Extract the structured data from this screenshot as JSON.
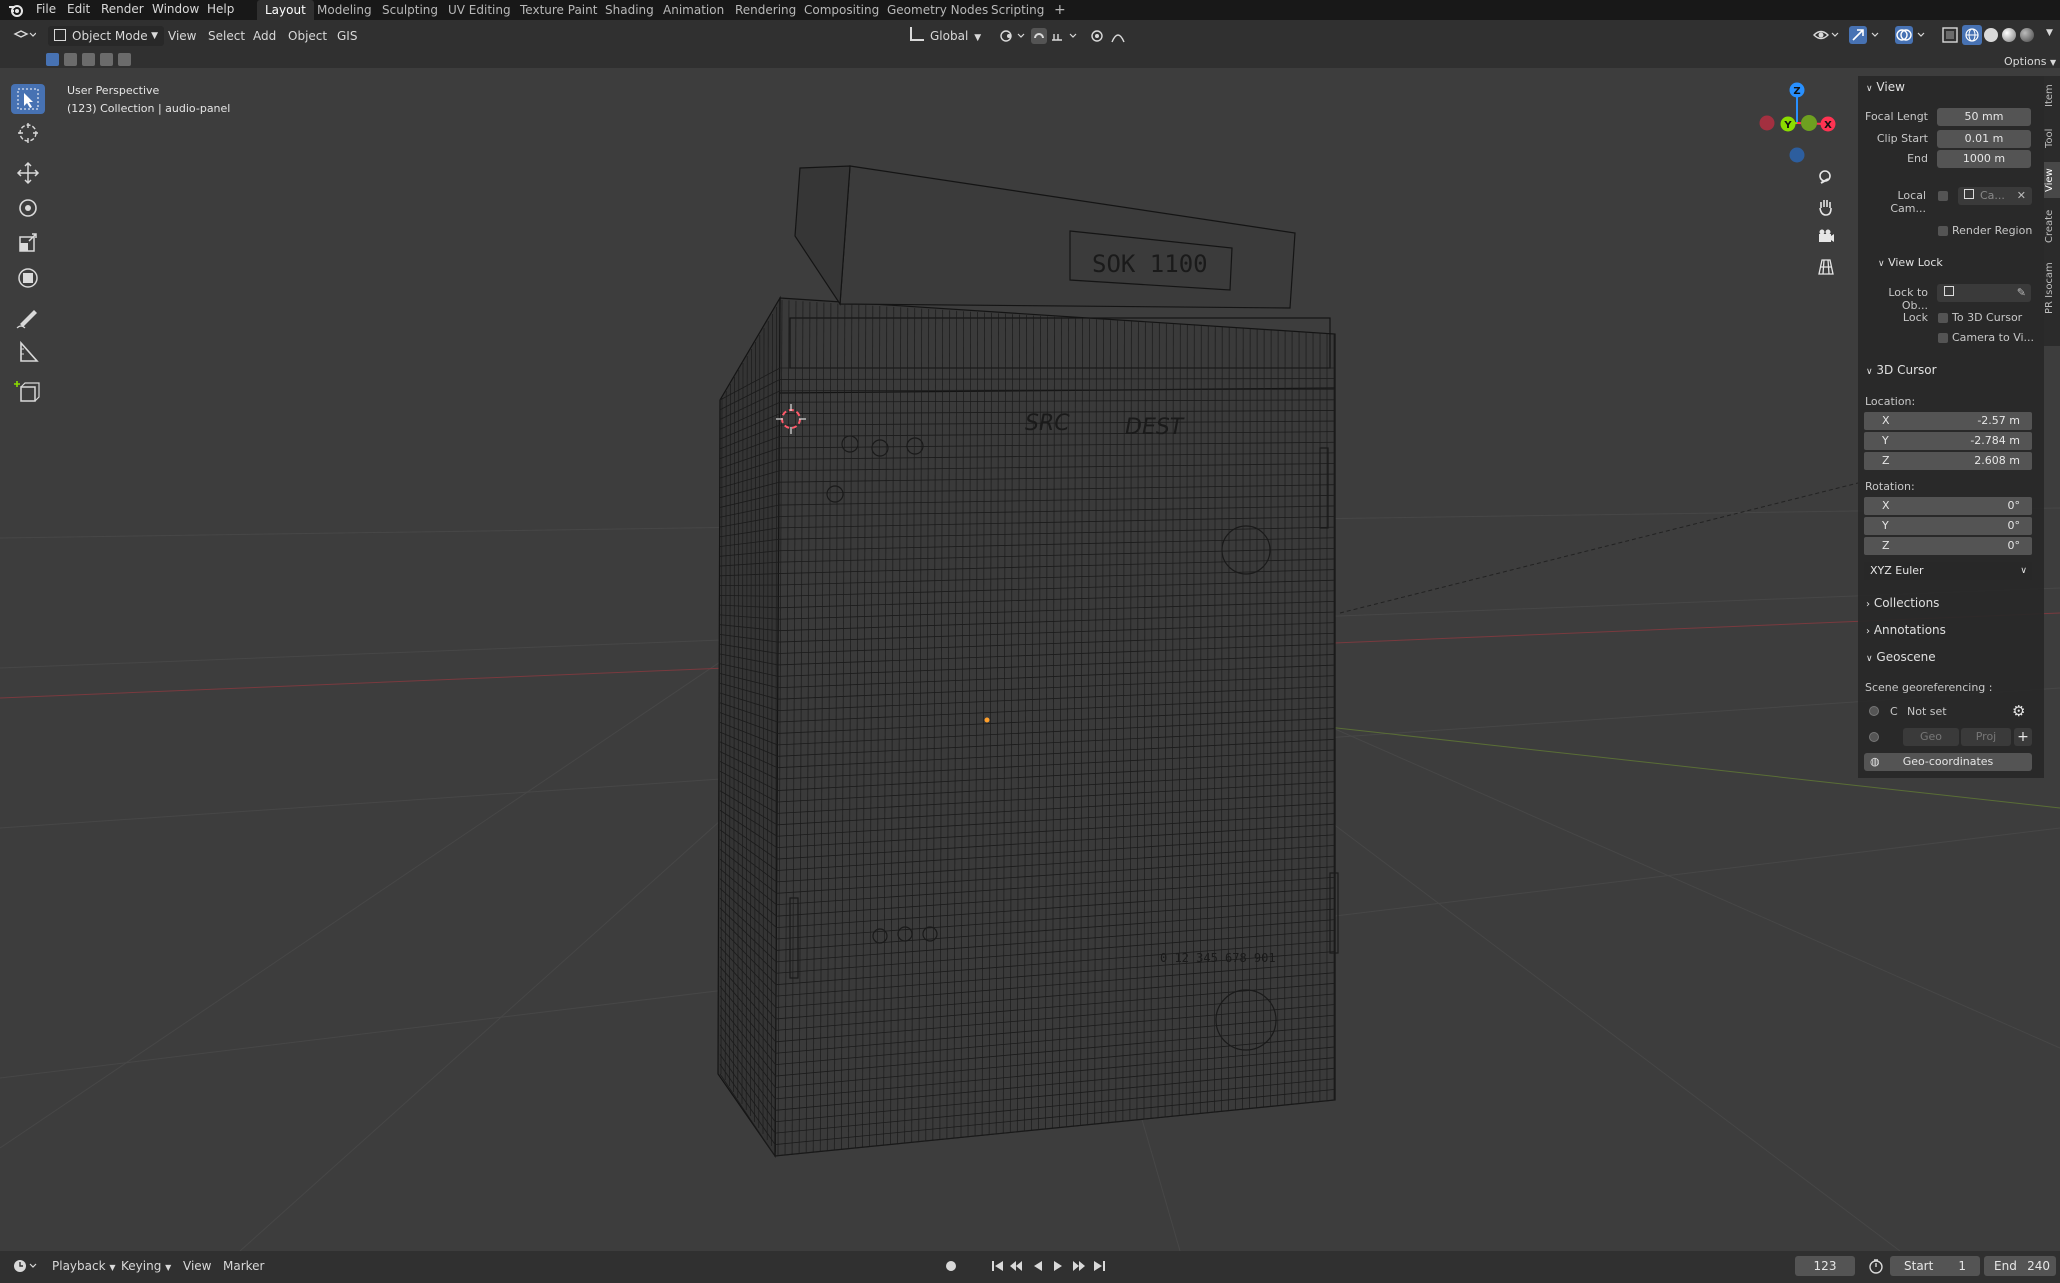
{
  "menubar": {
    "items": [
      "File",
      "Edit",
      "Render",
      "Window",
      "Help"
    ],
    "workspaces": [
      "Layout",
      "Modeling",
      "Sculpting",
      "UV Editing",
      "Texture Paint",
      "Shading",
      "Animation",
      "Rendering",
      "Compositing",
      "Geometry Nodes",
      "Scripting"
    ],
    "active_workspace": "Layout",
    "add_tab": "+"
  },
  "header": {
    "mode": "Object Mode",
    "menus": [
      "View",
      "Select",
      "Add",
      "Object",
      "GIS"
    ],
    "orientation": "Global",
    "options": "Options"
  },
  "viewport": {
    "perspective": "User Perspective",
    "collection": "(123) Collection | audio-panel",
    "gizmo": {
      "x": "X",
      "y": "Y",
      "z": "Z"
    },
    "model_text": {
      "top_display": "SOK 1100",
      "src": "SRC",
      "dest": "DEST",
      "counter": "0 12 345 678 901"
    }
  },
  "npanel": {
    "tabs": [
      "Item",
      "Tool",
      "View",
      "Create",
      "PR Isocam"
    ],
    "view": {
      "title": "View",
      "focal_label": "Focal Lengt",
      "focal_value": "50 mm",
      "clip_start_label": "Clip Start",
      "clip_start_value": "0.01 m",
      "end_label": "End",
      "end_value": "1000 m",
      "local_cam_label": "Local Cam...",
      "local_cam_value": "Ca...",
      "render_region": "Render Region"
    },
    "view_lock": {
      "title": "View Lock",
      "lock_to_label": "Lock to Ob...",
      "lock_label": "Lock",
      "to_cursor": "To 3D Cursor",
      "camera_to_view": "Camera to Vi..."
    },
    "cursor": {
      "title": "3D Cursor",
      "location_label": "Location:",
      "location": [
        {
          "axis": "X",
          "value": "-2.57 m"
        },
        {
          "axis": "Y",
          "value": "-2.784 m"
        },
        {
          "axis": "Z",
          "value": "2.608 m"
        }
      ],
      "rotation_label": "Rotation:",
      "rotation": [
        {
          "axis": "X",
          "value": "0°"
        },
        {
          "axis": "Y",
          "value": "0°"
        },
        {
          "axis": "Z",
          "value": "0°"
        }
      ],
      "rotation_mode": "XYZ Euler"
    },
    "collections": "Collections",
    "annotations": "Annotations",
    "geoscene": {
      "title": "Geoscene",
      "georef_label": "Scene georeferencing :",
      "crs_prefix": "C",
      "crs_value": "Not set",
      "geo_btn": "Geo",
      "proj_btn": "Proj",
      "add": "+",
      "geo_coords": "Geo-coordinates"
    }
  },
  "timeline": {
    "menus": [
      "Playback",
      "Keying",
      "View",
      "Marker"
    ],
    "current_frame": "123",
    "start_label": "Start",
    "start": "1",
    "end_label": "End",
    "end": "240"
  },
  "colors": {
    "accent": "#4772b3",
    "x_axis": "#ff3352",
    "y_axis": "#8bdc00",
    "z_axis": "#2890ff",
    "wire": "#111111"
  }
}
